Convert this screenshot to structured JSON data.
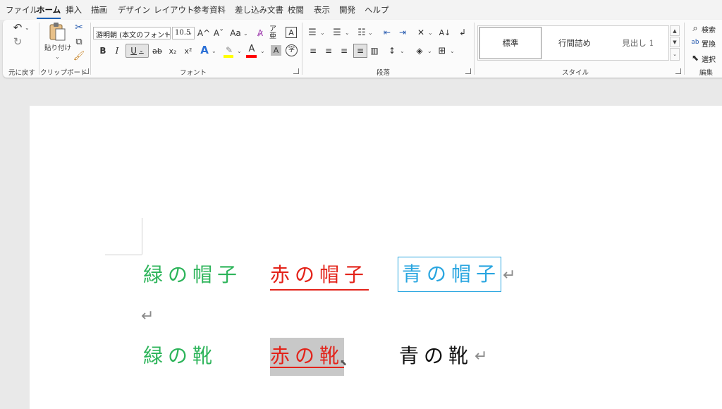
{
  "menu": {
    "tabs": [
      {
        "label": "ファイル"
      },
      {
        "label": "ホーム",
        "active": true
      },
      {
        "label": "挿入"
      },
      {
        "label": "描画"
      },
      {
        "label": "デザイン"
      },
      {
        "label": "レイアウト"
      },
      {
        "label": "参考資料"
      },
      {
        "label": "差し込み文書"
      },
      {
        "label": "校閲"
      },
      {
        "label": "表示"
      },
      {
        "label": "開発"
      },
      {
        "label": "ヘルプ"
      }
    ]
  },
  "ribbon": {
    "undo_group": {
      "label": "元に戻す",
      "undo_icon": "undo-icon",
      "redo_icon": "redo-icon"
    },
    "clipboard": {
      "label": "クリップボード",
      "paste_label": "貼り付け",
      "cut_icon": "scissors-icon",
      "copy_icon": "copy-icon",
      "format_painter_icon": "paintbrush-icon"
    },
    "font": {
      "label": "フォント",
      "font_name": "游明朝 (本文のフォント",
      "font_size": "10.5",
      "grow_label": "A^",
      "shrink_label": "Aˇ",
      "case_label": "Aa",
      "bold_label": "B",
      "italic_label": "I",
      "underline_label": "U",
      "strike_label": "ab",
      "sub_label": "x₂",
      "sup_label": "x²",
      "highlight_color": "#ffff00",
      "font_color": "#ff0000"
    },
    "paragraph": {
      "label": "段落"
    },
    "styles": {
      "label": "スタイル",
      "items": [
        "標準",
        "行間詰め",
        "見出し 1"
      ]
    },
    "editing": {
      "label": "編集",
      "find_label": "検索",
      "replace_label": "置換",
      "select_label": "選択"
    }
  },
  "document": {
    "line1": {
      "green": "緑の帽子",
      "red": "赤の帽子",
      "blue": "青の帽子"
    },
    "line3": {
      "green": "緑の靴",
      "red": "赤の靴",
      "black": "青の靴"
    },
    "colors": {
      "green": "#2db45a",
      "red": "#e3231a",
      "blue": "#2aa6e0",
      "black": "#111111",
      "selection_bg": "#c8c8c8"
    }
  }
}
